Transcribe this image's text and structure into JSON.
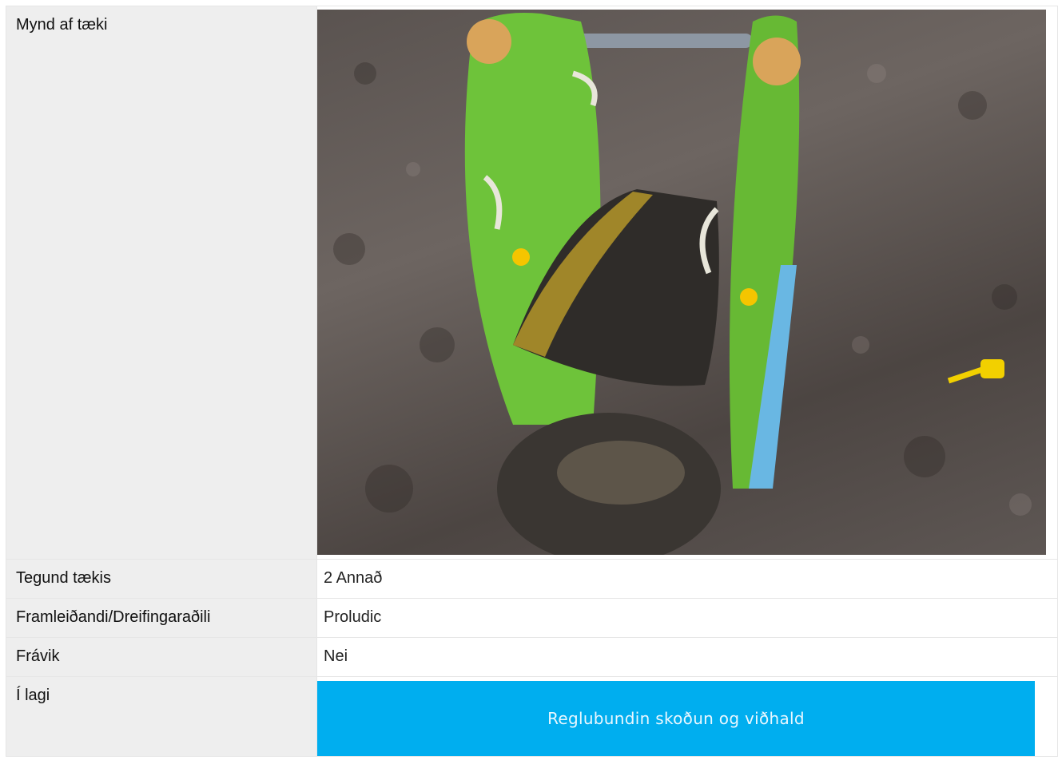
{
  "rows": {
    "photo_label": "Mynd af tæki",
    "type_label": "Tegund tækis",
    "type_value": "2 Annað",
    "manufacturer_label": "Framleiðandi/Dreifingaraðili",
    "manufacturer_value": "Proludic",
    "deviation_label": "Frávik",
    "deviation_value": "Nei",
    "ok_label": "Í lagi",
    "ok_banner": "Reglubundin skoðun og viðhald"
  },
  "colors": {
    "label_background": "#eeeeee",
    "banner": "#00aeef",
    "equipment_green": "#6ec33a"
  },
  "photo": {
    "subject": "green playground rocker on dark sand"
  }
}
